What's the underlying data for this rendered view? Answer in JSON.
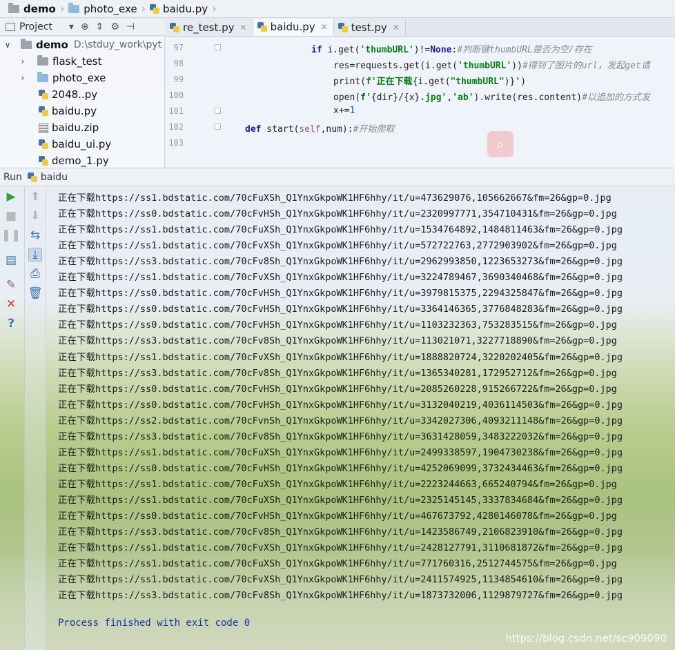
{
  "breadcrumb": [
    "demo",
    "photo_exe",
    "baidu.py"
  ],
  "project_panel": {
    "label": "Project",
    "tree": [
      {
        "name": "demo",
        "path": "D:\\stduy_work\\pyt",
        "type": "root"
      },
      {
        "name": "flask_test",
        "type": "folder-grey"
      },
      {
        "name": "photo_exe",
        "type": "folder"
      },
      {
        "name": "2048..py",
        "type": "py"
      },
      {
        "name": "baidu.py",
        "type": "py"
      },
      {
        "name": "baidu.zip",
        "type": "zip"
      },
      {
        "name": "baidu_ui.py",
        "type": "py"
      },
      {
        "name": "demo_1.py",
        "type": "py"
      }
    ]
  },
  "tabs": [
    {
      "label": "re_test.py",
      "active": false
    },
    {
      "label": "baidu.py",
      "active": true
    },
    {
      "label": "test.py",
      "active": false
    }
  ],
  "editor": {
    "line_numbers": [
      "97",
      "98",
      "99",
      "100",
      "101",
      "102",
      "103"
    ]
  },
  "run": {
    "label": "Run",
    "config": "baidu",
    "prefix": "正在下载",
    "lines": [
      "https://ss1.bdstatic.com/70cFuXSh_Q1YnxGkpoWK1HF6hhy/it/u=473629076,105662667&fm=26&gp=0.jpg",
      "https://ss0.bdstatic.com/70cFvHSh_Q1YnxGkpoWK1HF6hhy/it/u=2320997771,354710431&fm=26&gp=0.jpg",
      "https://ss1.bdstatic.com/70cFuXSh_Q1YnxGkpoWK1HF6hhy/it/u=1534764892,1484811463&fm=26&gp=0.jpg",
      "https://ss1.bdstatic.com/70cFvXSh_Q1YnxGkpoWK1HF6hhy/it/u=572722763,2772903902&fm=26&gp=0.jpg",
      "https://ss3.bdstatic.com/70cFv8Sh_Q1YnxGkpoWK1HF6hhy/it/u=2962993850,1223653273&fm=26&gp=0.jpg",
      "https://ss1.bdstatic.com/70cFvXSh_Q1YnxGkpoWK1HF6hhy/it/u=3224789467,3690340468&fm=26&gp=0.jpg",
      "https://ss0.bdstatic.com/70cFvHSh_Q1YnxGkpoWK1HF6hhy/it/u=3979815375,2294325847&fm=26&gp=0.jpg",
      "https://ss0.bdstatic.com/70cFvHSh_Q1YnxGkpoWK1HF6hhy/it/u=3364146365,3776848283&fm=26&gp=0.jpg",
      "https://ss0.bdstatic.com/70cFvHSh_Q1YnxGkpoWK1HF6hhy/it/u=1103232363,753283515&fm=26&gp=0.jpg",
      "https://ss3.bdstatic.com/70cFv8Sh_Q1YnxGkpoWK1HF6hhy/it/u=113021071,3227718890&fm=26&gp=0.jpg",
      "https://ss1.bdstatic.com/70cFvXSh_Q1YnxGkpoWK1HF6hhy/it/u=1888820724,3220202405&fm=26&gp=0.jpg",
      "https://ss3.bdstatic.com/70cFv8Sh_Q1YnxGkpoWK1HF6hhy/it/u=1365340281,172952712&fm=26&gp=0.jpg",
      "https://ss0.bdstatic.com/70cFvHSh_Q1YnxGkpoWK1HF6hhy/it/u=2085260228,915266722&fm=26&gp=0.jpg",
      "https://ss0.bdstatic.com/70cFvHSh_Q1YnxGkpoWK1HF6hhy/it/u=3132040219,4036114503&fm=26&gp=0.jpg",
      "https://ss2.bdstatic.com/70cFvnSh_Q1YnxGkpoWK1HF6hhy/it/u=3342027306,4093211148&fm=26&gp=0.jpg",
      "https://ss3.bdstatic.com/70cFv8Sh_Q1YnxGkpoWK1HF6hhy/it/u=3631428059,3483222032&fm=26&gp=0.jpg",
      "https://ss1.bdstatic.com/70cFuXSh_Q1YnxGkpoWK1HF6hhy/it/u=2499338597,1904730238&fm=26&gp=0.jpg",
      "https://ss0.bdstatic.com/70cFvHSh_Q1YnxGkpoWK1HF6hhy/it/u=4252069099,3732434463&fm=26&gp=0.jpg",
      "https://ss1.bdstatic.com/70cFuXSh_Q1YnxGkpoWK1HF6hhy/it/u=2223244663,665240794&fm=26&gp=0.jpg",
      "https://ss1.bdstatic.com/70cFuXSh_Q1YnxGkpoWK1HF6hhy/it/u=2325145145,3337834684&fm=26&gp=0.jpg",
      "https://ss0.bdstatic.com/70cFvHSh_Q1YnxGkpoWK1HF6hhy/it/u=467673792,4280146078&fm=26&gp=0.jpg",
      "https://ss3.bdstatic.com/70cFv8Sh_Q1YnxGkpoWK1HF6hhy/it/u=1423586749,2106823910&fm=26&gp=0.jpg",
      "https://ss1.bdstatic.com/70cFvXSh_Q1YnxGkpoWK1HF6hhy/it/u=2428127791,3110681872&fm=26&gp=0.jpg",
      "https://ss1.bdstatic.com/70cFuXSh_Q1YnxGkpoWK1HF6hhy/it/u=771760316,2512744575&fm=26&gp=0.jpg",
      "https://ss1.bdstatic.com/70cFvXSh_Q1YnxGkpoWK1HF6hhy/it/u=2411574925,1134854610&fm=26&gp=0.jpg",
      "https://ss3.bdstatic.com/70cFv8Sh_Q1YnxGkpoWK1HF6hhy/it/u=1873732006,1129879727&fm=26&gp=0.jpg"
    ],
    "exit_message": "Process finished with exit code 0"
  },
  "watermark": "https://blog.csdn.net/sc909090"
}
